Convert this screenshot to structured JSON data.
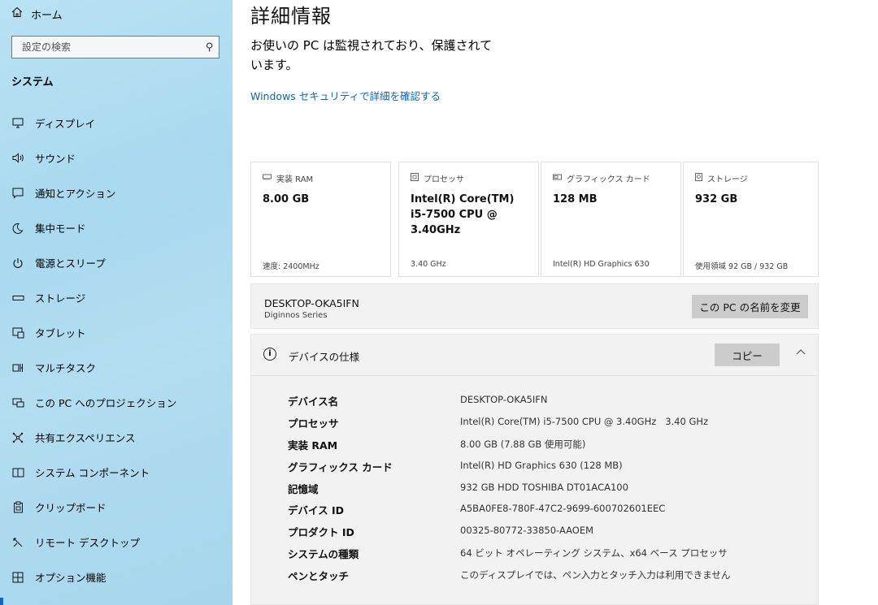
{
  "sidebar": {
    "home": {
      "label": "ホーム",
      "icon": "home-icon"
    },
    "search": {
      "placeholder": "設定の検索",
      "icon": "search-icon"
    },
    "section": "システム",
    "items": [
      {
        "label": "ディスプレイ",
        "icon": "monitor-icon"
      },
      {
        "label": "サウンド",
        "icon": "speaker-icon"
      },
      {
        "label": "通知とアクション",
        "icon": "notification-icon"
      },
      {
        "label": "集中モード",
        "icon": "moon-icon"
      },
      {
        "label": "電源とスリープ",
        "icon": "power-icon"
      },
      {
        "label": "ストレージ",
        "icon": "storage-icon"
      },
      {
        "label": "タブレット",
        "icon": "tablet-icon"
      },
      {
        "label": "マルチタスク",
        "icon": "multitask-icon"
      },
      {
        "label": "この PC へのプロジェクション",
        "icon": "projection-icon"
      },
      {
        "label": "共有エクスペリエンス",
        "icon": "share-icon"
      },
      {
        "label": "システム コンポーネント",
        "icon": "components-icon"
      },
      {
        "label": "クリップボード",
        "icon": "clipboard-icon"
      },
      {
        "label": "リモート デスクトップ",
        "icon": "remote-desktop-icon"
      },
      {
        "label": "オプション機能",
        "icon": "optional-features-icon"
      }
    ]
  },
  "main": {
    "title": "詳細情報",
    "protection_text": "お使いの PC は監視されており、保護されています。",
    "security_link": "Windows セキュリティで詳細を確認する",
    "cards": [
      {
        "caption": "実装 RAM",
        "icon": "ram-icon",
        "value": "8.00 GB",
        "sub": "速度: 2400MHz"
      },
      {
        "caption": "プロセッサ",
        "icon": "cpu-icon",
        "value": "Intel(R) Core(TM) i5-7500 CPU @ 3.40GHz",
        "sub": "3.40 GHz"
      },
      {
        "caption": "グラフィックス カード",
        "icon": "gpu-icon",
        "value": "128 MB",
        "sub": "Intel(R) HD Graphics 630"
      },
      {
        "caption": "ストレージ",
        "icon": "disk-icon",
        "value": "932 GB",
        "sub": "使用領域 92 GB / 932 GB"
      }
    ],
    "pc": {
      "name": "DESKTOP-OKA5IFN",
      "series": "Diginnos Series",
      "rename_label": "この PC の名前を変更"
    },
    "spec": {
      "title": "デバイスの仕様",
      "copy_label": "コピー",
      "rows": [
        {
          "key": "デバイス名",
          "value": "DESKTOP-OKA5IFN"
        },
        {
          "key": "プロセッサ",
          "value": "Intel(R) Core(TM) i5-7500 CPU @ 3.40GHz   3.40 GHz"
        },
        {
          "key": "実装 RAM",
          "value": "8.00 GB (7.88 GB 使用可能)"
        },
        {
          "key": "グラフィックス カード",
          "value": "Intel(R) HD Graphics 630 (128 MB)"
        },
        {
          "key": "記憶域",
          "value": "932 GB HDD TOSHIBA DT01ACA100"
        },
        {
          "key": "デバイス ID",
          "value": "A5BA0FE8-780F-47C2-9699-600702601EEC"
        },
        {
          "key": "プロダクト ID",
          "value": "00325-80772-33850-AAOEM"
        },
        {
          "key": "システムの種類",
          "value": "64 ビット オペレーティング システム、x64 ベース プロセッサ"
        },
        {
          "key": "ペンとタッチ",
          "value": "このディスプレイでは、ペン入力とタッチ入力は利用できません"
        }
      ]
    }
  },
  "colors": {
    "sidebar_bg": "#b3ddf1",
    "accent": "#0a66b6",
    "panel_bg": "#f2f2f2",
    "button_bg": "#cccccc"
  }
}
